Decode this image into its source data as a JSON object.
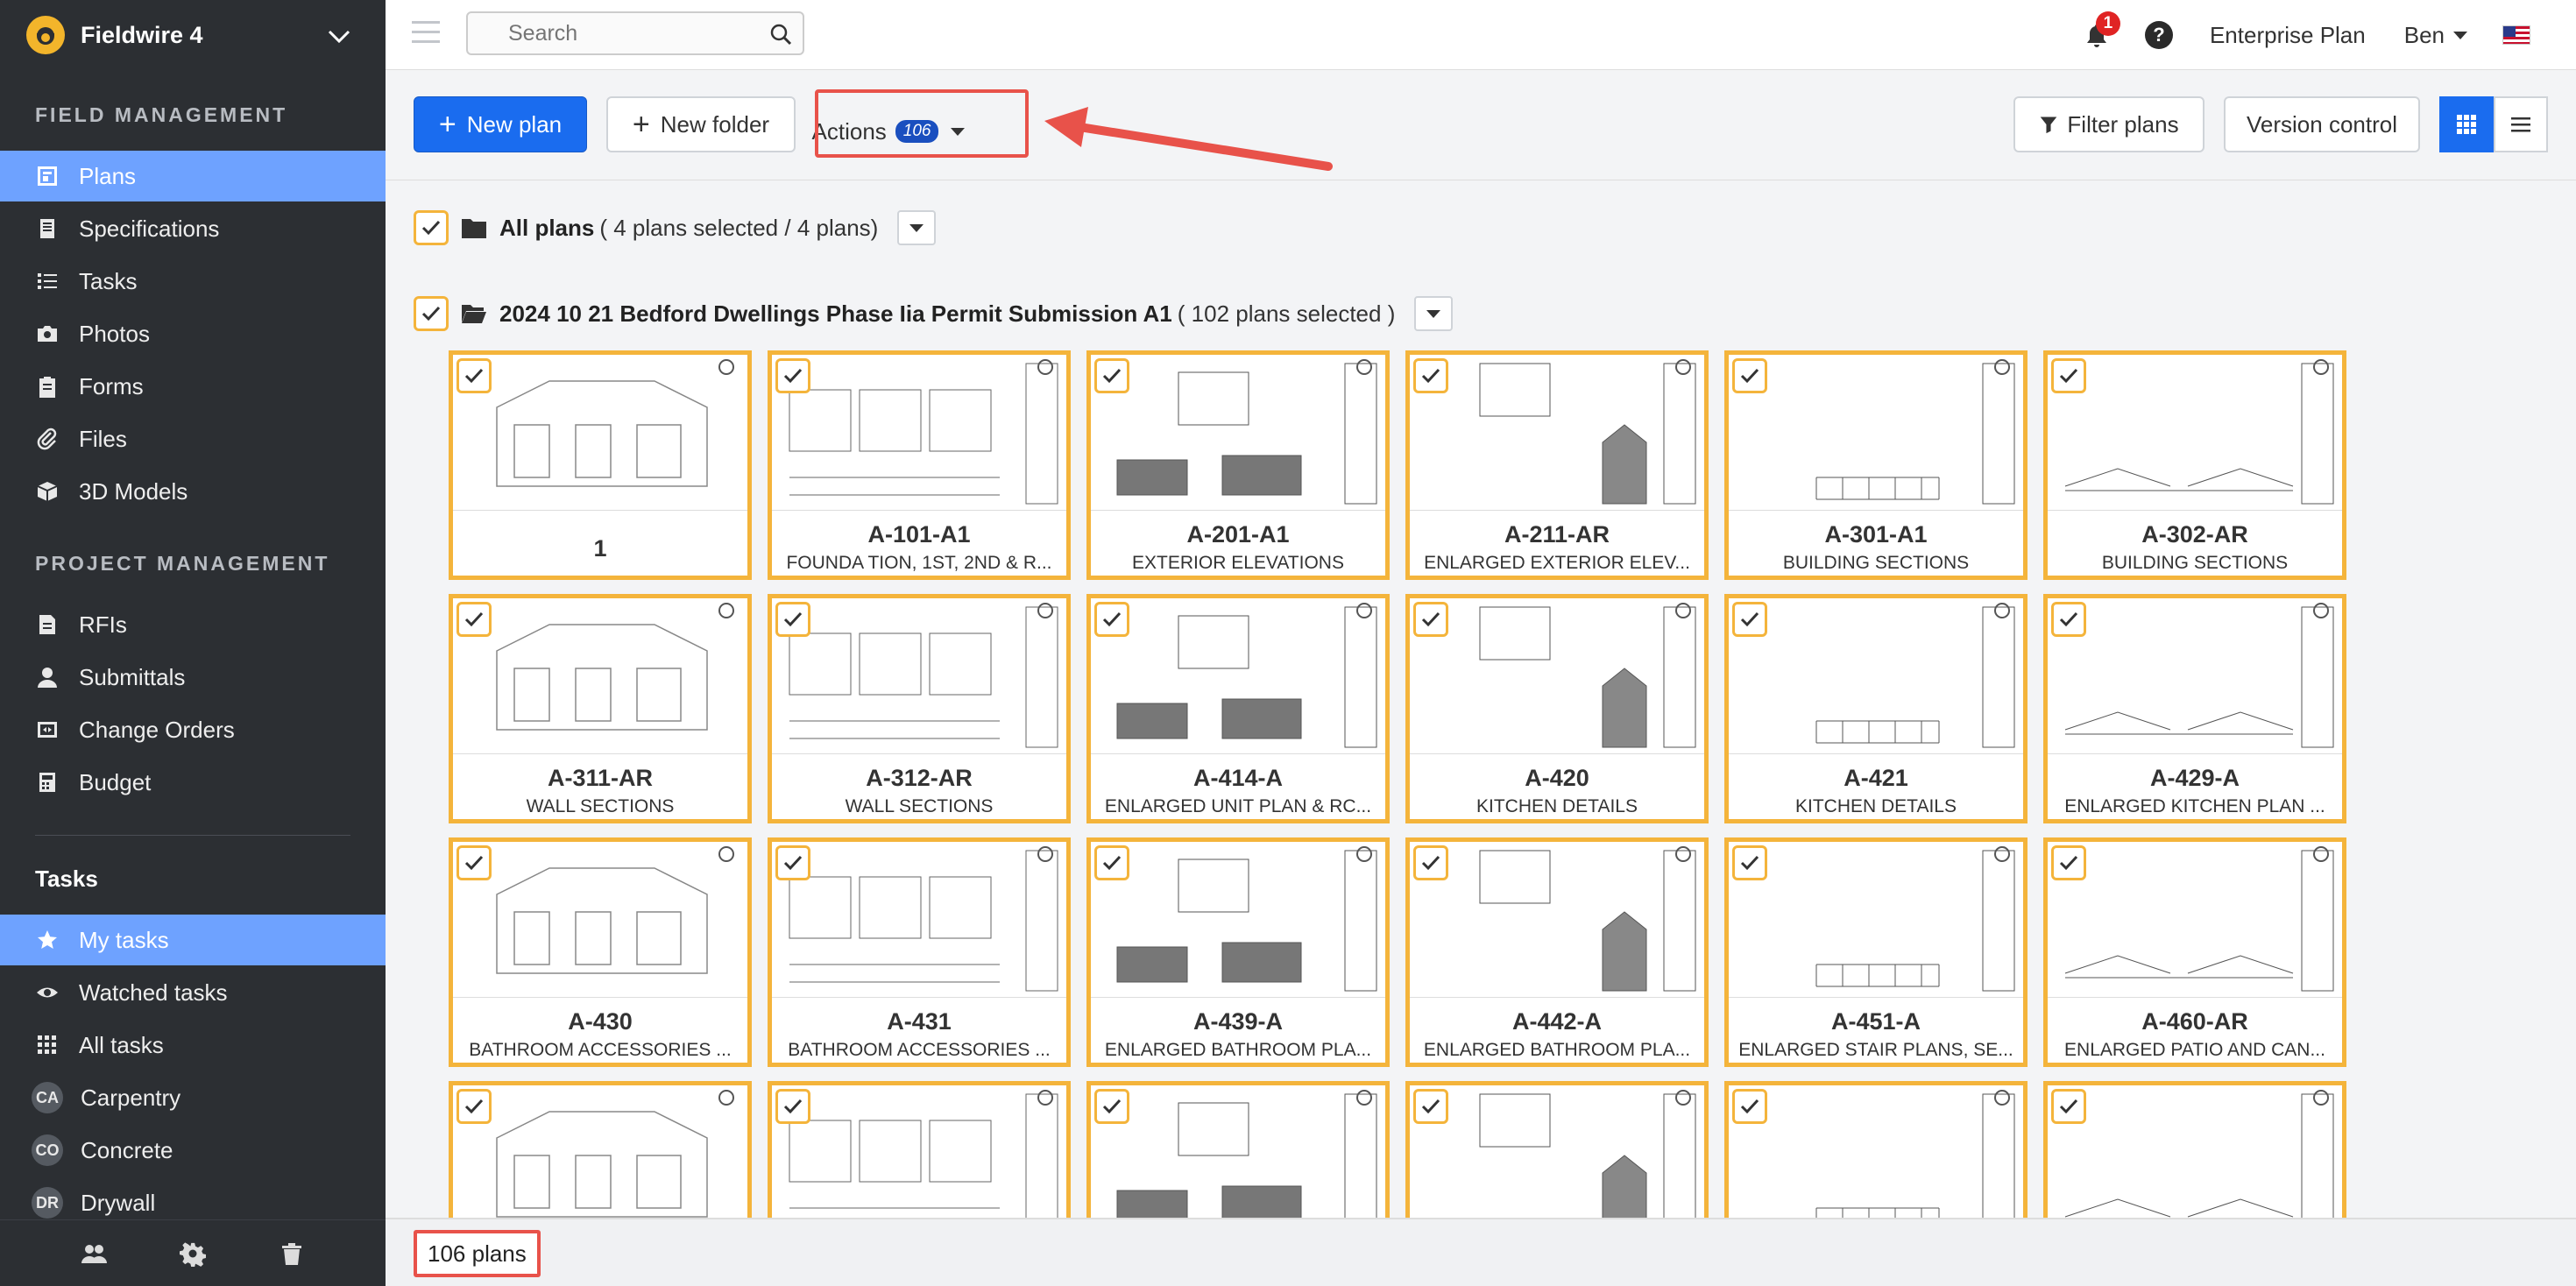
{
  "app": {
    "title": "Fieldwire 4"
  },
  "sidebar": {
    "section_field": "FIELD MANAGEMENT",
    "field_items": [
      {
        "label": "Plans",
        "icon": "plans-icon",
        "active": true
      },
      {
        "label": "Specifications",
        "icon": "specifications-icon"
      },
      {
        "label": "Tasks",
        "icon": "tasks-icon"
      },
      {
        "label": "Photos",
        "icon": "camera-icon"
      },
      {
        "label": "Forms",
        "icon": "clipboard-icon"
      },
      {
        "label": "Files",
        "icon": "paperclip-icon"
      },
      {
        "label": "3D Models",
        "icon": "cube-icon"
      }
    ],
    "section_project": "PROJECT MANAGEMENT",
    "project_items": [
      {
        "label": "RFIs",
        "icon": "rfi-icon"
      },
      {
        "label": "Submittals",
        "icon": "person-icon"
      },
      {
        "label": "Change Orders",
        "icon": "change-orders-icon"
      },
      {
        "label": "Budget",
        "icon": "calculator-icon"
      }
    ],
    "tasks_heading": "Tasks",
    "task_items": [
      {
        "label": "My tasks",
        "icon": "star-icon",
        "active": true
      },
      {
        "label": "Watched tasks",
        "icon": "eye-icon"
      },
      {
        "label": "All tasks",
        "icon": "grid-icon"
      },
      {
        "label": "Carpentry",
        "avatar": "CA"
      },
      {
        "label": "Concrete",
        "avatar": "CO"
      },
      {
        "label": "Drywall",
        "avatar": "DR"
      }
    ]
  },
  "topbar": {
    "search_placeholder": "Search",
    "notification_count": "1",
    "help": "?",
    "plan_label": "Enterprise Plan",
    "user": "Ben"
  },
  "toolbar": {
    "new_plan": "New plan",
    "new_folder": "New folder",
    "actions": "Actions",
    "actions_count": "106",
    "filter_plans": "Filter plans",
    "version_control": "Version control"
  },
  "groups": {
    "all_plans": {
      "name": "All plans",
      "meta": "( 4 plans selected / 4 plans)"
    },
    "folder": {
      "name": "2024 10 21 Bedford Dwellings Phase Iia Permit Submission A1",
      "meta": "( 102 plans selected )"
    }
  },
  "plans": [
    {
      "title": "1",
      "subtitle": ""
    },
    {
      "title": "A-101-A1",
      "subtitle": "FOUNDA TION, 1ST, 2ND & R..."
    },
    {
      "title": "A-201-A1",
      "subtitle": "EXTERIOR ELEVATIONS"
    },
    {
      "title": "A-211-AR",
      "subtitle": "ENLARGED EXTERIOR ELEV..."
    },
    {
      "title": "A-301-A1",
      "subtitle": "BUILDING SECTIONS"
    },
    {
      "title": "A-302-AR",
      "subtitle": "BUILDING SECTIONS"
    },
    {
      "title": "A-311-AR",
      "subtitle": "WALL SECTIONS"
    },
    {
      "title": "A-312-AR",
      "subtitle": "WALL SECTIONS"
    },
    {
      "title": "A-414-A",
      "subtitle": "ENLARGED UNIT PLAN & RC..."
    },
    {
      "title": "A-420",
      "subtitle": "KITCHEN DETAILS"
    },
    {
      "title": "A-421",
      "subtitle": "KITCHEN DETAILS"
    },
    {
      "title": "A-429-A",
      "subtitle": "ENLARGED KITCHEN PLAN ..."
    },
    {
      "title": "A-430",
      "subtitle": "BATHROOM ACCESSORIES ..."
    },
    {
      "title": "A-431",
      "subtitle": "BATHROOM ACCESSORIES ..."
    },
    {
      "title": "A-439-A",
      "subtitle": "ENLARGED BATHROOM PLA..."
    },
    {
      "title": "A-442-A",
      "subtitle": "ENLARGED BATHROOM PLA..."
    },
    {
      "title": "A-451-A",
      "subtitle": "ENLARGED STAIR PLANS, SE..."
    },
    {
      "title": "A-460-AR",
      "subtitle": "ENLARGED PATIO AND CAN..."
    },
    {
      "title": "",
      "subtitle": ""
    },
    {
      "title": "",
      "subtitle": ""
    },
    {
      "title": "",
      "subtitle": ""
    },
    {
      "title": "",
      "subtitle": ""
    },
    {
      "title": "",
      "subtitle": ""
    },
    {
      "title": "",
      "subtitle": ""
    }
  ],
  "footer": {
    "count": "106 plans"
  },
  "colors": {
    "accent": "#1a6cef",
    "selection": "#f4b43b",
    "annotation": "#e8524a",
    "sidebar_bg": "#2c2f33",
    "sidebar_active": "#6ea2ff"
  }
}
